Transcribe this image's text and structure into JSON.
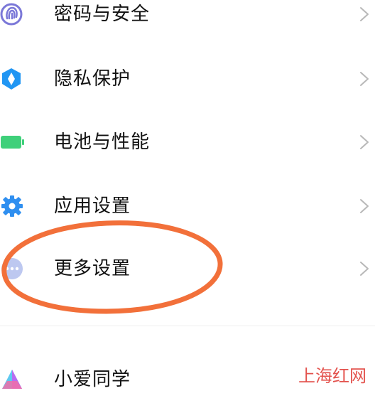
{
  "settings": {
    "items": [
      {
        "label": "密码与安全",
        "icon": "fingerprint-icon"
      },
      {
        "label": "隐私保护",
        "icon": "privacy-shield-icon"
      },
      {
        "label": "电池与性能",
        "icon": "battery-icon"
      },
      {
        "label": "应用设置",
        "icon": "gear-icon"
      },
      {
        "label": "更多设置",
        "icon": "more-dots-icon"
      },
      {
        "label": "小爱同学",
        "icon": "xiaoai-icon"
      }
    ]
  },
  "colors": {
    "label_text": "#111111",
    "chevron": "#b8b8b8",
    "fingerprint": "#7b78d8",
    "privacy": "#2196f3",
    "battery": "#3fd07a",
    "gear": "#2f8ff0",
    "more_dots_bg": "#bdc8f0",
    "annotation_ring": "#f2703a",
    "watermark": "#e0403a"
  },
  "watermark": {
    "text": "上海红网"
  }
}
